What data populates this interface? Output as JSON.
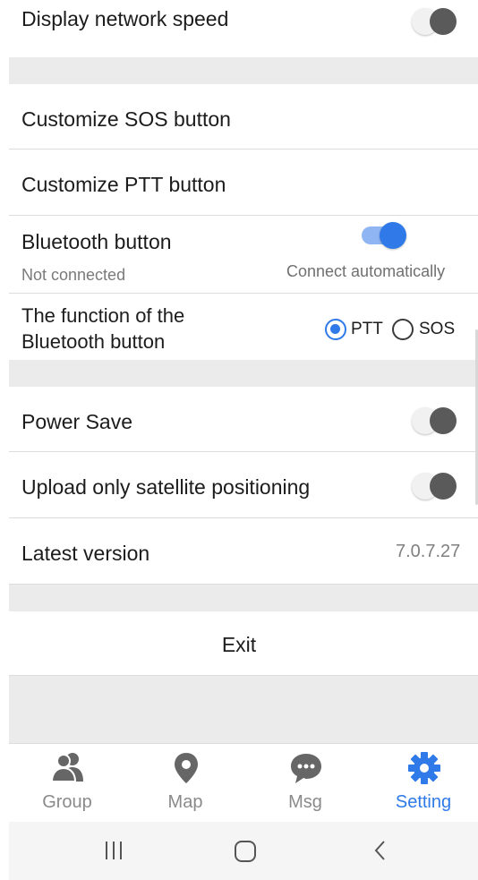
{
  "settings": {
    "display_network_speed": {
      "label": "Display network speed",
      "enabled": false
    },
    "customize_sos": {
      "label": "Customize SOS button"
    },
    "customize_ptt": {
      "label": "Customize PTT button"
    },
    "bluetooth_button": {
      "label": "Bluetooth button",
      "status": "Not connected",
      "auto_label": "Connect automatically",
      "enabled": true
    },
    "bluetooth_function": {
      "label_line1": "The function of the",
      "label_line2": "Bluetooth button",
      "options": [
        "PTT",
        "SOS"
      ],
      "selected": "PTT"
    },
    "power_save": {
      "label": "Power Save",
      "enabled": false
    },
    "upload_satellite": {
      "label": "Upload only satellite positioning",
      "enabled": false
    },
    "latest_version": {
      "label": "Latest version",
      "value": "7.0.7.27"
    },
    "exit": {
      "label": "Exit"
    }
  },
  "tabbar": {
    "tabs": [
      {
        "label": "Group",
        "icon": "group-icon"
      },
      {
        "label": "Map",
        "icon": "map-pin-icon"
      },
      {
        "label": "Msg",
        "icon": "chat-icon"
      },
      {
        "label": "Setting",
        "icon": "gear-icon"
      }
    ],
    "active": "Setting"
  },
  "navbar": {
    "buttons": [
      "recent-apps",
      "home",
      "back"
    ]
  },
  "colors": {
    "accent": "#2f7ae8",
    "inactive": "#8a8a8a",
    "section_gap": "#ebebeb"
  }
}
